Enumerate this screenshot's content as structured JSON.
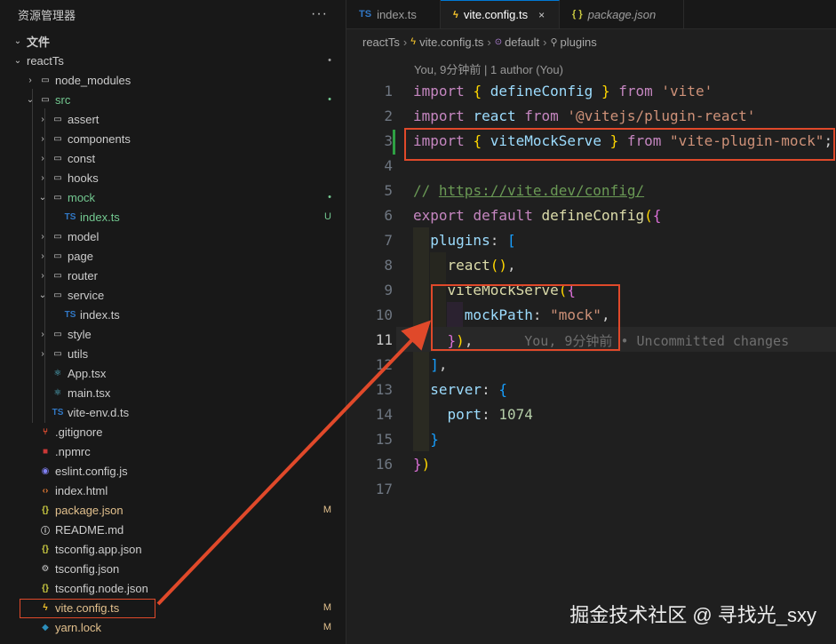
{
  "sidebar": {
    "title": "资源管理器",
    "more": "···",
    "section": "文件",
    "rows": [
      {
        "label": "reactTs",
        "chev": "v",
        "icon": "",
        "badge": "•",
        "depth": 0,
        "cls": "",
        "bcls": "c-dim"
      },
      {
        "label": "node_modules",
        "chev": ">",
        "icon": "folder",
        "badge": "",
        "depth": 1,
        "cls": "",
        "bcls": ""
      },
      {
        "label": "src",
        "chev": "v",
        "icon": "folder",
        "badge": "•",
        "depth": 1,
        "cls": "c-green",
        "bcls": "c-green"
      },
      {
        "label": "assert",
        "chev": ">",
        "icon": "folder",
        "badge": "",
        "depth": 2,
        "cls": "",
        "bcls": ""
      },
      {
        "label": "components",
        "chev": ">",
        "icon": "folder",
        "badge": "",
        "depth": 2,
        "cls": "",
        "bcls": ""
      },
      {
        "label": "const",
        "chev": ">",
        "icon": "folder",
        "badge": "",
        "depth": 2,
        "cls": "",
        "bcls": ""
      },
      {
        "label": "hooks",
        "chev": ">",
        "icon": "folder",
        "badge": "",
        "depth": 2,
        "cls": "",
        "bcls": ""
      },
      {
        "label": "mock",
        "chev": "v",
        "icon": "folder",
        "badge": "•",
        "depth": 2,
        "cls": "c-green",
        "bcls": "c-green"
      },
      {
        "label": "index.ts",
        "chev": "",
        "icon": "TS",
        "badge": "U",
        "depth": 3,
        "cls": "c-green",
        "bcls": "c-green"
      },
      {
        "label": "model",
        "chev": ">",
        "icon": "folder",
        "badge": "",
        "depth": 2,
        "cls": "",
        "bcls": ""
      },
      {
        "label": "page",
        "chev": ">",
        "icon": "folder",
        "badge": "",
        "depth": 2,
        "cls": "",
        "bcls": ""
      },
      {
        "label": "router",
        "chev": ">",
        "icon": "folder",
        "badge": "",
        "depth": 2,
        "cls": "",
        "bcls": ""
      },
      {
        "label": "service",
        "chev": "v",
        "icon": "folder",
        "badge": "",
        "depth": 2,
        "cls": "",
        "bcls": ""
      },
      {
        "label": "index.ts",
        "chev": "",
        "icon": "TS",
        "badge": "",
        "depth": 3,
        "cls": "",
        "bcls": ""
      },
      {
        "label": "style",
        "chev": ">",
        "icon": "folder",
        "badge": "",
        "depth": 2,
        "cls": "",
        "bcls": ""
      },
      {
        "label": "utils",
        "chev": ">",
        "icon": "folder",
        "badge": "",
        "depth": 2,
        "cls": "",
        "bcls": ""
      },
      {
        "label": "App.tsx",
        "chev": "",
        "icon": "react",
        "badge": "",
        "depth": 2,
        "cls": "",
        "bcls": ""
      },
      {
        "label": "main.tsx",
        "chev": "",
        "icon": "react",
        "badge": "",
        "depth": 2,
        "cls": "",
        "bcls": ""
      },
      {
        "label": "vite-env.d.ts",
        "chev": "",
        "icon": "TS",
        "badge": "",
        "depth": 2,
        "cls": "",
        "bcls": ""
      },
      {
        "label": ".gitignore",
        "chev": "",
        "icon": "git",
        "badge": "",
        "depth": 1,
        "cls": "",
        "bcls": ""
      },
      {
        "label": ".npmrc",
        "chev": "",
        "icon": "npm",
        "badge": "",
        "depth": 1,
        "cls": "",
        "bcls": ""
      },
      {
        "label": "eslint.config.js",
        "chev": "",
        "icon": "eslint",
        "badge": "",
        "depth": 1,
        "cls": "",
        "bcls": ""
      },
      {
        "label": "index.html",
        "chev": "",
        "icon": "html",
        "badge": "",
        "depth": 1,
        "cls": "",
        "bcls": ""
      },
      {
        "label": "package.json",
        "chev": "",
        "icon": "json",
        "badge": "M",
        "depth": 1,
        "cls": "c-mod",
        "bcls": "c-mod"
      },
      {
        "label": "README.md",
        "chev": "",
        "icon": "info",
        "badge": "",
        "depth": 1,
        "cls": "",
        "bcls": ""
      },
      {
        "label": "tsconfig.app.json",
        "chev": "",
        "icon": "json",
        "badge": "",
        "depth": 1,
        "cls": "",
        "bcls": ""
      },
      {
        "label": "tsconfig.json",
        "chev": "",
        "icon": "gear",
        "badge": "",
        "depth": 1,
        "cls": "",
        "bcls": ""
      },
      {
        "label": "tsconfig.node.json",
        "chev": "",
        "icon": "json",
        "badge": "",
        "depth": 1,
        "cls": "",
        "bcls": ""
      },
      {
        "label": "vite.config.ts",
        "chev": "",
        "icon": "vite",
        "badge": "M",
        "depth": 1,
        "cls": "c-mod",
        "bcls": "c-mod"
      },
      {
        "label": "yarn.lock",
        "chev": "",
        "icon": "yarn",
        "badge": "M",
        "depth": 1,
        "cls": "c-mod",
        "bcls": "c-mod"
      }
    ]
  },
  "tabs": [
    {
      "label": "index.ts",
      "icon": "TS",
      "active": false,
      "italic": false
    },
    {
      "label": "vite.config.ts",
      "icon": "vite",
      "active": true,
      "italic": false,
      "close": "×"
    },
    {
      "label": "package.json",
      "icon": "{ }",
      "active": false,
      "italic": true
    }
  ],
  "breadcrumb": [
    "reactTs",
    "vite.config.ts",
    "default",
    "plugins"
  ],
  "blame_header": "You, 9分钟前 | 1 author (You)",
  "line_numbers": [
    "1",
    "2",
    "3",
    "4",
    "5",
    "6",
    "7",
    "8",
    "9",
    "10",
    "11",
    "12",
    "13",
    "14",
    "15",
    "16",
    "17"
  ],
  "code": {
    "l1": [
      "import",
      "{",
      "defineConfig",
      "}",
      "from",
      "'vite'"
    ],
    "l2": [
      "import",
      "react",
      "from",
      "'@vitejs/plugin-react'"
    ],
    "l3": [
      "import",
      "{",
      "viteMockServe",
      "}",
      "from",
      "\"vite-plugin-mock\"",
      ";"
    ],
    "l5": [
      "//",
      "https://vite.dev/config/"
    ],
    "l6": [
      "export",
      "default",
      "defineConfig",
      "(",
      "{"
    ],
    "l7": [
      "plugins",
      ":",
      "["
    ],
    "l8": [
      "react",
      "()",
      ","
    ],
    "l9": [
      "viteMockServe",
      "(",
      "{"
    ],
    "l10": [
      "mockPath",
      ":",
      "\"mock\"",
      ","
    ],
    "l11": [
      "}",
      ")",
      ","
    ],
    "l11_blame": "You, 9分钟前 • Uncommitted changes",
    "l12": [
      "]",
      ","
    ],
    "l13": [
      "server",
      ":",
      "{"
    ],
    "l14": [
      "port",
      ":",
      "1074"
    ],
    "l15": [
      "}"
    ],
    "l16": [
      "}",
      ")"
    ]
  },
  "watermark": "掘金技术社区 @ 寻找光_sxy",
  "colors": {
    "annotation": "#e0492a",
    "accent": "#0078d4"
  }
}
